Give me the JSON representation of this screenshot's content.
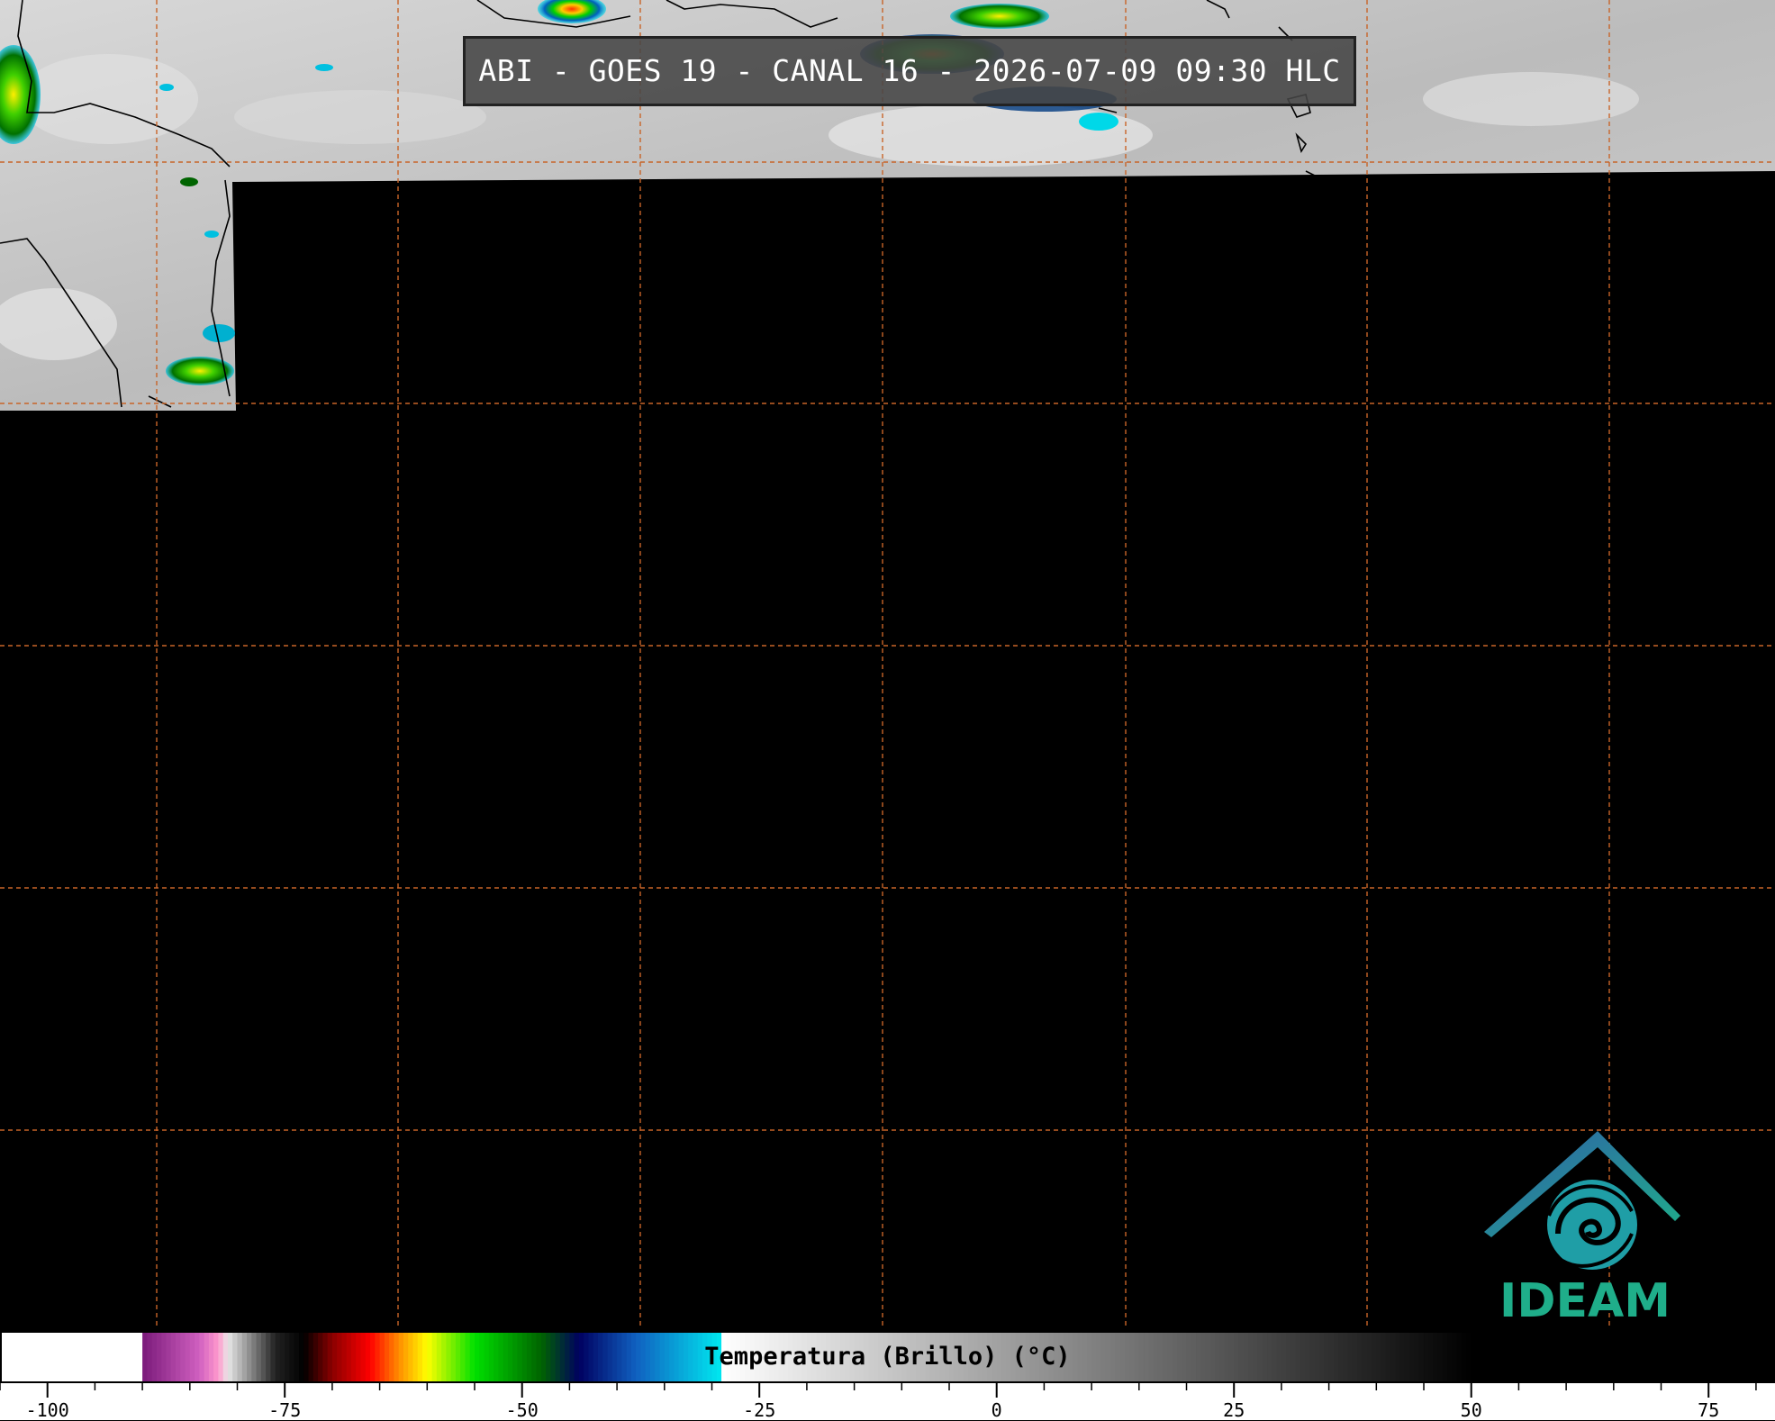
{
  "title": "ABI - GOES 19 - CANAL 16 - 2026-07-09 09:30 HLC",
  "logo": {
    "text": "IDEAM",
    "color": "#1fae8a"
  },
  "colorbar": {
    "label": "Temperatura (Brillo) (°C)",
    "min": -105,
    "max": 82,
    "major_ticks": [
      -100,
      -75,
      -50,
      -25,
      0,
      25,
      50,
      75
    ],
    "tick_labels": [
      "-100",
      "-75",
      "-50",
      "-25",
      "0",
      "25",
      "50",
      "75"
    ],
    "minor_tick_step": 5,
    "stops": [
      {
        "t": -105,
        "color": "#ffffff"
      },
      {
        "t": -90.1,
        "color": "#ffffff"
      },
      {
        "t": -90,
        "color": "#7a1a7a"
      },
      {
        "t": -84,
        "color": "#d060c0"
      },
      {
        "t": -82,
        "color": "#ff99cc"
      },
      {
        "t": -81,
        "color": "#e8e8e8"
      },
      {
        "t": -76,
        "color": "#222222"
      },
      {
        "t": -73,
        "color": "#000000"
      },
      {
        "t": -70,
        "color": "#8b0000"
      },
      {
        "t": -66,
        "color": "#ff0000"
      },
      {
        "t": -63,
        "color": "#ff8c00"
      },
      {
        "t": -60,
        "color": "#ffff00"
      },
      {
        "t": -55,
        "color": "#00e000"
      },
      {
        "t": -48,
        "color": "#006400"
      },
      {
        "t": -44,
        "color": "#000060"
      },
      {
        "t": -38,
        "color": "#1060c0"
      },
      {
        "t": -29,
        "color": "#00e8f0"
      },
      {
        "t": -28.9,
        "color": "#ffffff"
      },
      {
        "t": 50,
        "color": "#000000"
      },
      {
        "t": 82,
        "color": "#000000"
      }
    ]
  },
  "map": {
    "grid_color": "#c86428",
    "no_data_color": "#000000"
  }
}
